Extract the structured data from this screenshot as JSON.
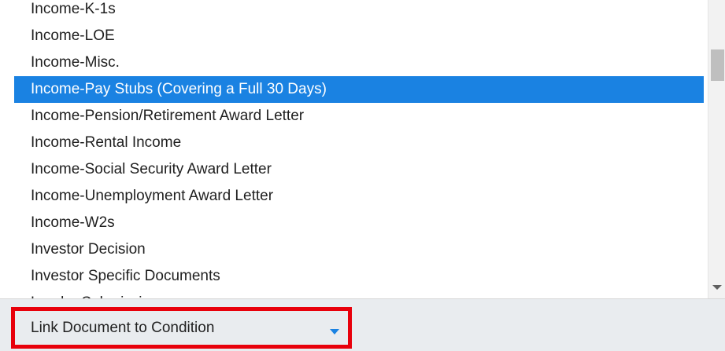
{
  "listbox": {
    "items": [
      {
        "label": "Income-K-1s"
      },
      {
        "label": "Income-LOE"
      },
      {
        "label": "Income-Misc."
      },
      {
        "label": "Income-Pay Stubs (Covering a Full 30 Days)",
        "selected": true
      },
      {
        "label": "Income-Pension/Retirement Award Letter"
      },
      {
        "label": "Income-Rental Income"
      },
      {
        "label": "Income-Social Security Award Letter"
      },
      {
        "label": "Income-Unemployment Award Letter"
      },
      {
        "label": "Income-W2s"
      },
      {
        "label": "Investor Decision"
      },
      {
        "label": "Investor Specific Documents"
      },
      {
        "label": "Lender Submission"
      }
    ]
  },
  "select": {
    "label": "Link Document to Condition"
  },
  "colors": {
    "selected_bg": "#1a82e2",
    "highlight_border": "#e8000b",
    "bar_bg": "#e9ecef"
  },
  "icons": {
    "scroll_down": "triangle-down",
    "select_caret": "caret-down"
  }
}
